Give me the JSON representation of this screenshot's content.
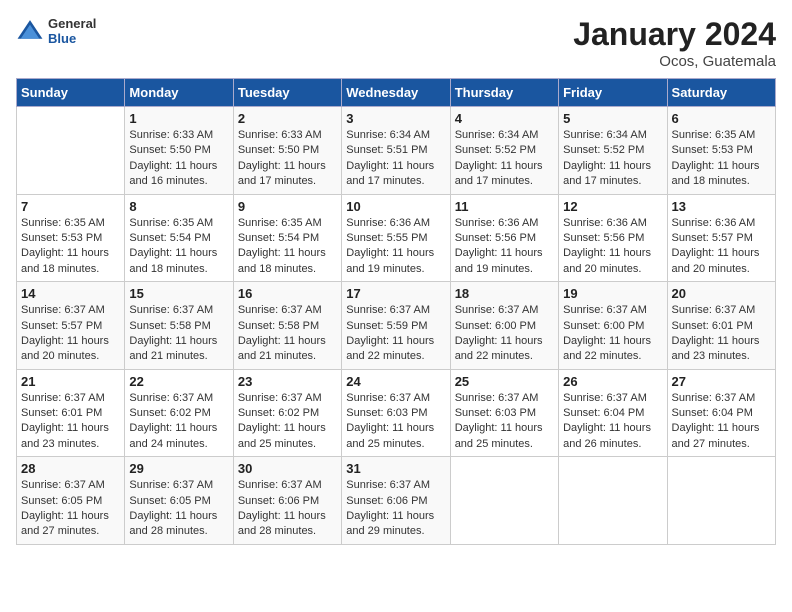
{
  "header": {
    "logo": {
      "general": "General",
      "blue": "Blue"
    },
    "title": "January 2024",
    "location": "Ocos, Guatemala"
  },
  "calendar": {
    "days_of_week": [
      "Sunday",
      "Monday",
      "Tuesday",
      "Wednesday",
      "Thursday",
      "Friday",
      "Saturday"
    ],
    "weeks": [
      [
        {
          "num": "",
          "sunrise": "",
          "sunset": "",
          "daylight": ""
        },
        {
          "num": "1",
          "sunrise": "Sunrise: 6:33 AM",
          "sunset": "Sunset: 5:50 PM",
          "daylight": "Daylight: 11 hours and 16 minutes."
        },
        {
          "num": "2",
          "sunrise": "Sunrise: 6:33 AM",
          "sunset": "Sunset: 5:50 PM",
          "daylight": "Daylight: 11 hours and 17 minutes."
        },
        {
          "num": "3",
          "sunrise": "Sunrise: 6:34 AM",
          "sunset": "Sunset: 5:51 PM",
          "daylight": "Daylight: 11 hours and 17 minutes."
        },
        {
          "num": "4",
          "sunrise": "Sunrise: 6:34 AM",
          "sunset": "Sunset: 5:52 PM",
          "daylight": "Daylight: 11 hours and 17 minutes."
        },
        {
          "num": "5",
          "sunrise": "Sunrise: 6:34 AM",
          "sunset": "Sunset: 5:52 PM",
          "daylight": "Daylight: 11 hours and 17 minutes."
        },
        {
          "num": "6",
          "sunrise": "Sunrise: 6:35 AM",
          "sunset": "Sunset: 5:53 PM",
          "daylight": "Daylight: 11 hours and 18 minutes."
        }
      ],
      [
        {
          "num": "7",
          "sunrise": "Sunrise: 6:35 AM",
          "sunset": "Sunset: 5:53 PM",
          "daylight": "Daylight: 11 hours and 18 minutes."
        },
        {
          "num": "8",
          "sunrise": "Sunrise: 6:35 AM",
          "sunset": "Sunset: 5:54 PM",
          "daylight": "Daylight: 11 hours and 18 minutes."
        },
        {
          "num": "9",
          "sunrise": "Sunrise: 6:35 AM",
          "sunset": "Sunset: 5:54 PM",
          "daylight": "Daylight: 11 hours and 18 minutes."
        },
        {
          "num": "10",
          "sunrise": "Sunrise: 6:36 AM",
          "sunset": "Sunset: 5:55 PM",
          "daylight": "Daylight: 11 hours and 19 minutes."
        },
        {
          "num": "11",
          "sunrise": "Sunrise: 6:36 AM",
          "sunset": "Sunset: 5:56 PM",
          "daylight": "Daylight: 11 hours and 19 minutes."
        },
        {
          "num": "12",
          "sunrise": "Sunrise: 6:36 AM",
          "sunset": "Sunset: 5:56 PM",
          "daylight": "Daylight: 11 hours and 20 minutes."
        },
        {
          "num": "13",
          "sunrise": "Sunrise: 6:36 AM",
          "sunset": "Sunset: 5:57 PM",
          "daylight": "Daylight: 11 hours and 20 minutes."
        }
      ],
      [
        {
          "num": "14",
          "sunrise": "Sunrise: 6:37 AM",
          "sunset": "Sunset: 5:57 PM",
          "daylight": "Daylight: 11 hours and 20 minutes."
        },
        {
          "num": "15",
          "sunrise": "Sunrise: 6:37 AM",
          "sunset": "Sunset: 5:58 PM",
          "daylight": "Daylight: 11 hours and 21 minutes."
        },
        {
          "num": "16",
          "sunrise": "Sunrise: 6:37 AM",
          "sunset": "Sunset: 5:58 PM",
          "daylight": "Daylight: 11 hours and 21 minutes."
        },
        {
          "num": "17",
          "sunrise": "Sunrise: 6:37 AM",
          "sunset": "Sunset: 5:59 PM",
          "daylight": "Daylight: 11 hours and 22 minutes."
        },
        {
          "num": "18",
          "sunrise": "Sunrise: 6:37 AM",
          "sunset": "Sunset: 6:00 PM",
          "daylight": "Daylight: 11 hours and 22 minutes."
        },
        {
          "num": "19",
          "sunrise": "Sunrise: 6:37 AM",
          "sunset": "Sunset: 6:00 PM",
          "daylight": "Daylight: 11 hours and 22 minutes."
        },
        {
          "num": "20",
          "sunrise": "Sunrise: 6:37 AM",
          "sunset": "Sunset: 6:01 PM",
          "daylight": "Daylight: 11 hours and 23 minutes."
        }
      ],
      [
        {
          "num": "21",
          "sunrise": "Sunrise: 6:37 AM",
          "sunset": "Sunset: 6:01 PM",
          "daylight": "Daylight: 11 hours and 23 minutes."
        },
        {
          "num": "22",
          "sunrise": "Sunrise: 6:37 AM",
          "sunset": "Sunset: 6:02 PM",
          "daylight": "Daylight: 11 hours and 24 minutes."
        },
        {
          "num": "23",
          "sunrise": "Sunrise: 6:37 AM",
          "sunset": "Sunset: 6:02 PM",
          "daylight": "Daylight: 11 hours and 25 minutes."
        },
        {
          "num": "24",
          "sunrise": "Sunrise: 6:37 AM",
          "sunset": "Sunset: 6:03 PM",
          "daylight": "Daylight: 11 hours and 25 minutes."
        },
        {
          "num": "25",
          "sunrise": "Sunrise: 6:37 AM",
          "sunset": "Sunset: 6:03 PM",
          "daylight": "Daylight: 11 hours and 25 minutes."
        },
        {
          "num": "26",
          "sunrise": "Sunrise: 6:37 AM",
          "sunset": "Sunset: 6:04 PM",
          "daylight": "Daylight: 11 hours and 26 minutes."
        },
        {
          "num": "27",
          "sunrise": "Sunrise: 6:37 AM",
          "sunset": "Sunset: 6:04 PM",
          "daylight": "Daylight: 11 hours and 27 minutes."
        }
      ],
      [
        {
          "num": "28",
          "sunrise": "Sunrise: 6:37 AM",
          "sunset": "Sunset: 6:05 PM",
          "daylight": "Daylight: 11 hours and 27 minutes."
        },
        {
          "num": "29",
          "sunrise": "Sunrise: 6:37 AM",
          "sunset": "Sunset: 6:05 PM",
          "daylight": "Daylight: 11 hours and 28 minutes."
        },
        {
          "num": "30",
          "sunrise": "Sunrise: 6:37 AM",
          "sunset": "Sunset: 6:06 PM",
          "daylight": "Daylight: 11 hours and 28 minutes."
        },
        {
          "num": "31",
          "sunrise": "Sunrise: 6:37 AM",
          "sunset": "Sunset: 6:06 PM",
          "daylight": "Daylight: 11 hours and 29 minutes."
        },
        {
          "num": "",
          "sunrise": "",
          "sunset": "",
          "daylight": ""
        },
        {
          "num": "",
          "sunrise": "",
          "sunset": "",
          "daylight": ""
        },
        {
          "num": "",
          "sunrise": "",
          "sunset": "",
          "daylight": ""
        }
      ]
    ]
  }
}
